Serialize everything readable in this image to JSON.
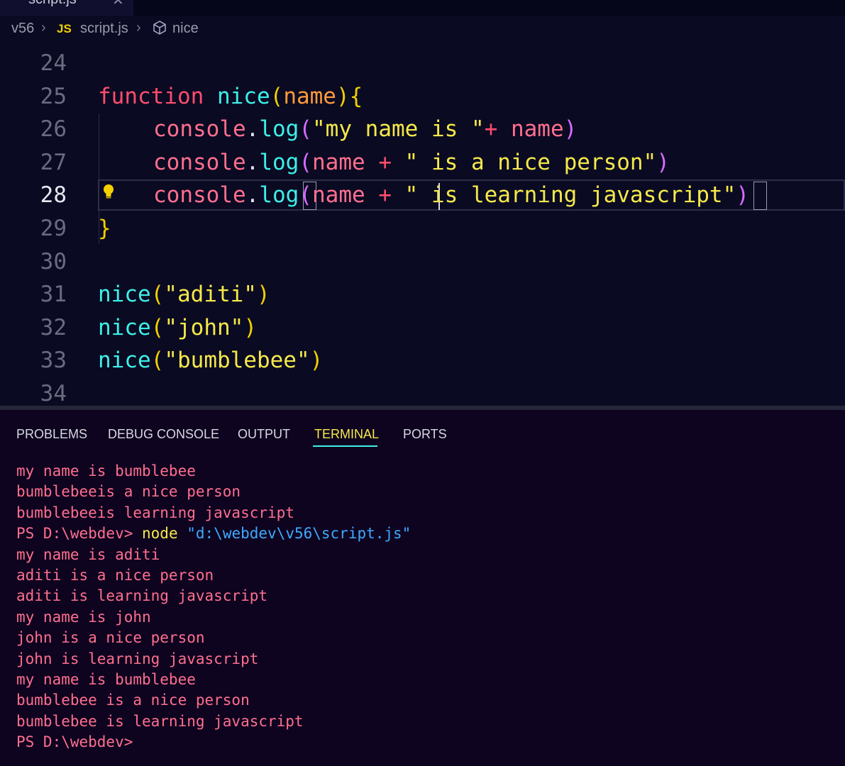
{
  "tab": {
    "label": "script.js",
    "close": "✕"
  },
  "breadcrumb": {
    "folder": "v56",
    "js_badge": "JS",
    "file": "script.js",
    "symbol": "nice"
  },
  "editor": {
    "active_line": "28",
    "lines": [
      {
        "num": "24",
        "tokens": []
      },
      {
        "num": "25",
        "tokens": [
          {
            "t": "function",
            "c": "t-kw"
          },
          {
            "t": " ",
            "c": ""
          },
          {
            "t": "nice",
            "c": "t-fn"
          },
          {
            "t": "(",
            "c": "t-paren"
          },
          {
            "t": "name",
            "c": "t-param"
          },
          {
            "t": ")",
            "c": "t-paren"
          },
          {
            "t": "{",
            "c": "t-paren"
          }
        ]
      },
      {
        "num": "26",
        "indent": true,
        "tokens": [
          {
            "t": "console",
            "c": "t-obj"
          },
          {
            "t": ".",
            "c": "t-dot"
          },
          {
            "t": "log",
            "c": "t-method"
          },
          {
            "t": "(",
            "c": "t-paren2"
          },
          {
            "t": "\"my name is \"",
            "c": "t-str"
          },
          {
            "t": "+",
            "c": "t-op"
          },
          {
            "t": " ",
            "c": ""
          },
          {
            "t": "name",
            "c": "t-var"
          },
          {
            "t": ")",
            "c": "t-paren2"
          }
        ]
      },
      {
        "num": "27",
        "indent": true,
        "tokens": [
          {
            "t": "console",
            "c": "t-obj"
          },
          {
            "t": ".",
            "c": "t-dot"
          },
          {
            "t": "log",
            "c": "t-method"
          },
          {
            "t": "(",
            "c": "t-paren2"
          },
          {
            "t": "name",
            "c": "t-var"
          },
          {
            "t": " + ",
            "c": "t-op"
          },
          {
            "t": "\" is a nice person\"",
            "c": "t-str"
          },
          {
            "t": ")",
            "c": "t-paren2"
          }
        ]
      },
      {
        "num": "28",
        "indent": true,
        "tokens": [
          {
            "t": "console",
            "c": "t-obj"
          },
          {
            "t": ".",
            "c": "t-dot"
          },
          {
            "t": "log",
            "c": "t-method"
          },
          {
            "t": "(",
            "c": "t-paren2"
          },
          {
            "t": "name",
            "c": "t-var"
          },
          {
            "t": " + ",
            "c": "t-op"
          },
          {
            "t": "\" is learning javascript\"",
            "c": "t-str"
          },
          {
            "t": ")",
            "c": "t-paren2"
          }
        ]
      },
      {
        "num": "29",
        "tokens": [
          {
            "t": "}",
            "c": "t-paren"
          }
        ]
      },
      {
        "num": "30",
        "tokens": []
      },
      {
        "num": "31",
        "tokens": [
          {
            "t": "nice",
            "c": "t-fn"
          },
          {
            "t": "(",
            "c": "t-paren"
          },
          {
            "t": "\"aditi\"",
            "c": "t-str"
          },
          {
            "t": ")",
            "c": "t-paren"
          }
        ]
      },
      {
        "num": "32",
        "tokens": [
          {
            "t": "nice",
            "c": "t-fn"
          },
          {
            "t": "(",
            "c": "t-paren"
          },
          {
            "t": "\"john\"",
            "c": "t-str"
          },
          {
            "t": ")",
            "c": "t-paren"
          }
        ]
      },
      {
        "num": "33",
        "tokens": [
          {
            "t": "nice",
            "c": "t-fn"
          },
          {
            "t": "(",
            "c": "t-paren"
          },
          {
            "t": "\"bumblebee\"",
            "c": "t-str"
          },
          {
            "t": ")",
            "c": "t-paren"
          }
        ]
      },
      {
        "num": "34",
        "tokens": []
      }
    ]
  },
  "panel": {
    "tabs": [
      {
        "label": "PROBLEMS",
        "active": false
      },
      {
        "label": "DEBUG CONSOLE",
        "active": false
      },
      {
        "label": "OUTPUT",
        "active": false
      },
      {
        "label": "TERMINAL",
        "active": true
      },
      {
        "label": "PORTS",
        "active": false
      }
    ]
  },
  "terminal": {
    "lines": [
      {
        "parts": [
          {
            "t": "my name is bumblebee",
            "c": ""
          }
        ]
      },
      {
        "parts": [
          {
            "t": "bumblebeeis a nice person",
            "c": ""
          }
        ]
      },
      {
        "parts": [
          {
            "t": "bumblebeeis learning javascript",
            "c": ""
          }
        ]
      },
      {
        "parts": [
          {
            "t": "PS D:\\webdev> ",
            "c": ""
          },
          {
            "t": "node",
            "c": "t-cmd"
          },
          {
            "t": " ",
            "c": ""
          },
          {
            "t": "\"d:\\webdev\\v56\\script.js\"",
            "c": "t-path"
          }
        ]
      },
      {
        "parts": [
          {
            "t": "my name is aditi",
            "c": ""
          }
        ]
      },
      {
        "parts": [
          {
            "t": "aditi is a nice person",
            "c": ""
          }
        ]
      },
      {
        "parts": [
          {
            "t": "aditi is learning javascript",
            "c": ""
          }
        ]
      },
      {
        "parts": [
          {
            "t": "my name is john",
            "c": ""
          }
        ]
      },
      {
        "parts": [
          {
            "t": "john is a nice person",
            "c": ""
          }
        ]
      },
      {
        "parts": [
          {
            "t": "john is learning javascript",
            "c": ""
          }
        ]
      },
      {
        "parts": [
          {
            "t": "my name is bumblebee",
            "c": ""
          }
        ]
      },
      {
        "parts": [
          {
            "t": "bumblebee is a nice person",
            "c": ""
          }
        ]
      },
      {
        "parts": [
          {
            "t": "bumblebee is learning javascript",
            "c": ""
          }
        ]
      },
      {
        "parts": [
          {
            "t": "PS D:\\webdev>",
            "c": ""
          }
        ]
      }
    ]
  },
  "colors": {
    "editor_bg": "#0a0a22",
    "terminal_bg": "#0e0420",
    "keyword": "#ff4d6d",
    "function": "#3df0e8",
    "string": "#f5e94a",
    "terminal_text": "#ff6f8e",
    "terminal_path": "#3fa9ff"
  }
}
